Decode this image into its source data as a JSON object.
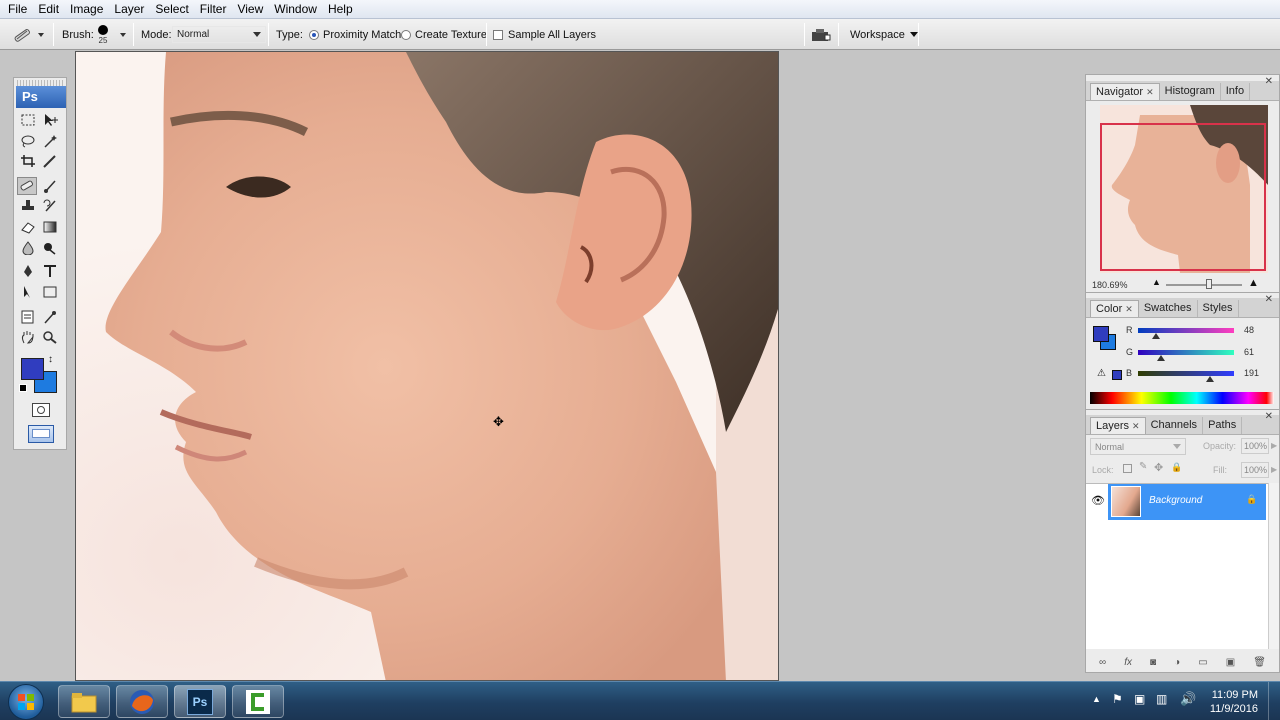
{
  "menubar": {
    "items": [
      "File",
      "Edit",
      "Image",
      "Layer",
      "Select",
      "Filter",
      "View",
      "Window",
      "Help"
    ]
  },
  "options": {
    "brush_label": "Brush:",
    "brush_size": "25",
    "mode_label": "Mode:",
    "mode_value": "Normal",
    "type_label": "Type:",
    "proximity_label": "Proximity Match",
    "create_texture_label": "Create Texture",
    "sample_all_layers_label": "Sample All Layers",
    "workspace_label": "Workspace"
  },
  "tools": {
    "logo": "Ps"
  },
  "navigator": {
    "tabs": [
      "Navigator",
      "Histogram",
      "Info"
    ],
    "zoom": "180.69%"
  },
  "color_panel": {
    "tabs": [
      "Color",
      "Swatches",
      "Styles"
    ],
    "r_label": "R",
    "g_label": "G",
    "b_label": "B",
    "r": 48,
    "g": 61,
    "b": 191,
    "foreground": "#303dbf",
    "background": "#1e7be0"
  },
  "layers_panel": {
    "tabs": [
      "Layers",
      "Channels",
      "Paths"
    ],
    "blend_mode": "Normal",
    "opacity_label": "Opacity:",
    "opacity_value": "100%",
    "lock_label": "Lock:",
    "fill_label": "Fill:",
    "fill_value": "100%",
    "layers": [
      {
        "name": "Background",
        "selected": true,
        "locked": true
      }
    ]
  },
  "taskbar": {
    "apps": [
      "explorer",
      "firefox",
      "photoshop",
      "camtasia"
    ],
    "time": "11:09 PM",
    "date": "11/9/2016"
  },
  "colors": {
    "accent": "#3a8ee6",
    "selected_layer": "#3d94f6"
  }
}
